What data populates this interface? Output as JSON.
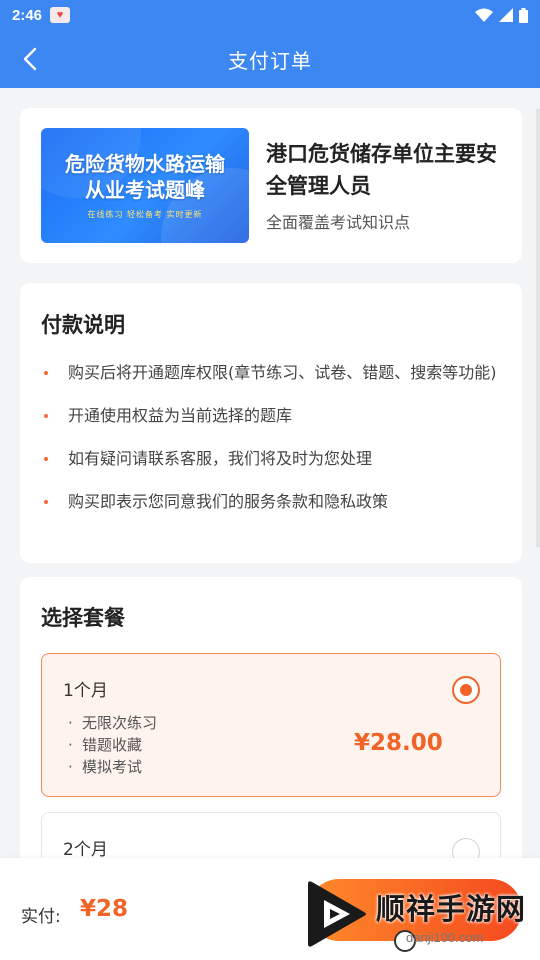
{
  "status_bar": {
    "time": "2:46",
    "app_icon": "heart-icon"
  },
  "header": {
    "title": "支付订单",
    "back_icon": "chevron-left-icon"
  },
  "product": {
    "image_line1": "危险货物水路运输",
    "image_line2": "从业考试题峰",
    "image_sub": "在线练习 轻松备考 实时更新",
    "title": "港口危货储存单位主要安全管理人员",
    "description": "全面覆盖考试知识点"
  },
  "notice": {
    "title": "付款说明",
    "items": [
      "购买后将开通题库权限(章节练习、试卷、错题、搜索等功能)",
      "开通使用权益为当前选择的题库",
      "如有疑问请联系客服，我们将及时为您处理",
      "购买即表示您同意我们的服务条款和隐私政策"
    ]
  },
  "plans": {
    "title": "选择套餐",
    "options": [
      {
        "name": "1个月",
        "features": [
          "无限次练习",
          "错题收藏",
          "模拟考试"
        ],
        "price": "¥28.00",
        "selected": true
      },
      {
        "name": "2个月",
        "selected": false
      }
    ]
  },
  "footer": {
    "total_label": "实付:",
    "total_amount": "¥28"
  },
  "watermark": {
    "text": "顺祥手游网",
    "url": "danji100.com"
  },
  "colors": {
    "header_blue": "#3d87f2",
    "accent_orange": "#f06428",
    "selected_bg": "#fff3ee"
  }
}
